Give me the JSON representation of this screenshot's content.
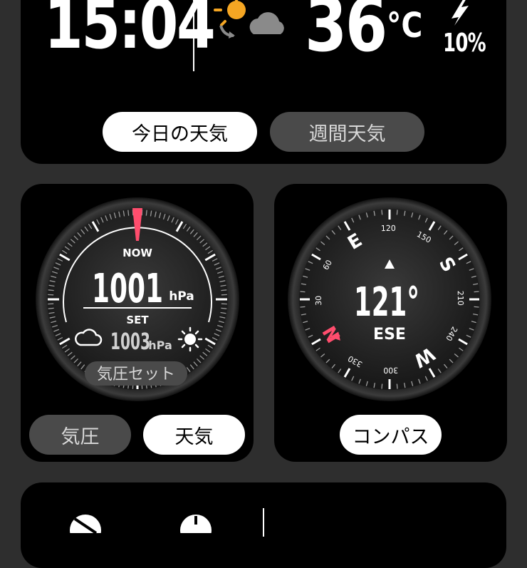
{
  "status": {
    "time": "15:04",
    "temperature": "36",
    "temp_unit": "°C",
    "battery": "10%",
    "weather_icon": "sun-to-cloud-icon"
  },
  "weather_tabs": [
    {
      "label": "今日の天気",
      "active": true
    },
    {
      "label": "週間天気",
      "active": false
    }
  ],
  "barometer": {
    "now_label": "NOW",
    "now_value": "1001",
    "unit": "hPa",
    "set_label": "SET",
    "set_value": "1003",
    "set_button": "気圧セット",
    "buttons": [
      {
        "label": "気圧",
        "active": false
      },
      {
        "label": "天気",
        "active": true
      }
    ]
  },
  "compass": {
    "heading": "121°",
    "direction": "ESE",
    "cardinals": [
      "E",
      "S",
      "W",
      "N"
    ],
    "scale_labels": [
      "120",
      "150",
      "210",
      "240",
      "300",
      "330",
      "30",
      "60"
    ],
    "button": "コンパス"
  },
  "colors": {
    "accent": "#ff4d6d",
    "card": "#000000",
    "background": "#2e2e2e"
  }
}
